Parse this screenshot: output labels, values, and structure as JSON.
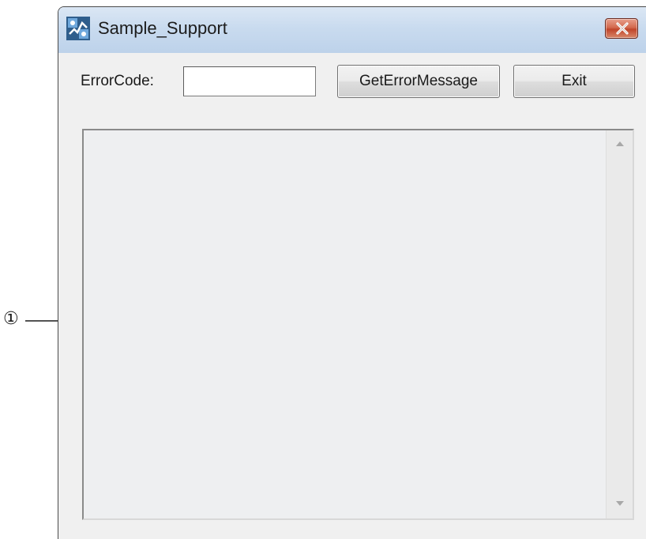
{
  "window": {
    "title": "Sample_Support",
    "icon": "app-icon"
  },
  "form": {
    "error_code_label": "ErrorCode:",
    "error_code_value": "",
    "get_message_button": "GetErrorMessage",
    "exit_button": "Exit"
  },
  "message_area": {
    "text": ""
  },
  "callout": {
    "number": "①"
  },
  "colors": {
    "titlebar": "#c9dbef",
    "close_button": "#c0452a",
    "client_background": "#f0f0f0"
  }
}
